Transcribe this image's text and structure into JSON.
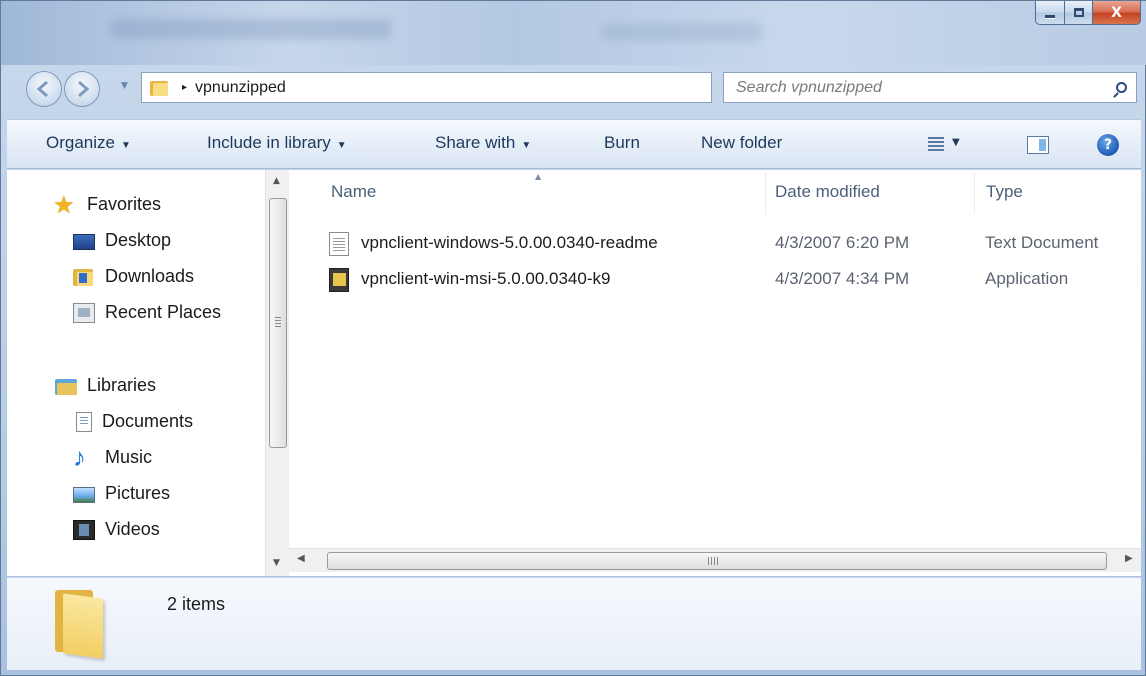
{
  "window": {
    "caption_buttons": {
      "minimize": "",
      "maximize": "",
      "close": "X"
    }
  },
  "navigation": {
    "back_icon": "back-arrow-icon",
    "forward_icon": "forward-arrow-icon",
    "address": {
      "separator": "▸",
      "breadcrumb": "vpnunzipped",
      "dropdown_icon": "chevron-down-icon",
      "refresh_glyph": "↻"
    },
    "search": {
      "placeholder": "Search vpnunzipped",
      "icon": "search-icon"
    }
  },
  "toolbar": {
    "organize": "Organize",
    "include_in_library": "Include in library",
    "share_with": "Share with",
    "burn": "Burn",
    "new_folder": "New folder",
    "arrow": "▼",
    "help_glyph": "?"
  },
  "nav_pane": {
    "favorites": {
      "label": "Favorites",
      "items": [
        {
          "label": "Desktop",
          "icon": "desktop-icon"
        },
        {
          "label": "Downloads",
          "icon": "downloads-folder-icon"
        },
        {
          "label": "Recent Places",
          "icon": "recent-places-icon"
        }
      ]
    },
    "libraries": {
      "label": "Libraries",
      "items": [
        {
          "label": "Documents",
          "icon": "documents-icon"
        },
        {
          "label": "Music",
          "icon": "music-icon"
        },
        {
          "label": "Pictures",
          "icon": "pictures-icon"
        },
        {
          "label": "Videos",
          "icon": "videos-icon"
        }
      ]
    }
  },
  "file_list": {
    "columns": {
      "name": "Name",
      "date_modified": "Date modified",
      "type": "Type"
    },
    "files": [
      {
        "name": "vpnclient-windows-5.0.00.0340-readme",
        "date_modified": "4/3/2007 6:20 PM",
        "type": "Text Document",
        "icon": "text-document-icon"
      },
      {
        "name": "vpnclient-win-msi-5.0.00.0340-k9",
        "date_modified": "4/3/2007 4:34 PM",
        "type": "Application",
        "icon": "application-icon"
      }
    ]
  },
  "details_pane": {
    "item_count": "2 items",
    "icon": "folder-icon"
  },
  "colors": {
    "frame": "#b8cde6",
    "toolbar_text": "#1e395b",
    "close_button": "#c2401f",
    "secondary_text": "#5c6370"
  }
}
